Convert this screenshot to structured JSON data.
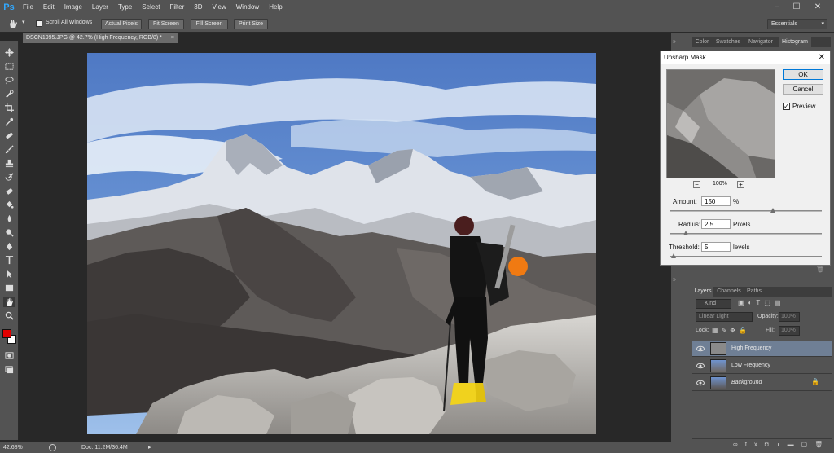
{
  "app": {
    "logo": "Ps"
  },
  "menu": [
    "File",
    "Edit",
    "Image",
    "Layer",
    "Type",
    "Select",
    "Filter",
    "3D",
    "View",
    "Window",
    "Help"
  ],
  "window_controls": {
    "minimize": "–",
    "maximize": "☐",
    "close": "✕"
  },
  "options_bar": {
    "scroll_all_windows": "Scroll All Windows",
    "buttons": [
      "Actual Pixels",
      "Fit Screen",
      "Fill Screen",
      "Print Size"
    ],
    "workspace": "Essentials"
  },
  "document": {
    "tab_title": "DSCN1995.JPG @ 42.7% (High Frequency, RGB/8) *",
    "close": "×"
  },
  "status": {
    "zoom": "42.68%",
    "doc": "Doc: 11.2M/36.4M"
  },
  "panel_tabs": [
    "Color",
    "Swatches",
    "Navigator",
    "Histogram"
  ],
  "dialog": {
    "title": "Unsharp Mask",
    "ok": "OK",
    "cancel": "Cancel",
    "preview_label": "Preview",
    "preview_checked": true,
    "zoom": "100%",
    "zoom_out": "−",
    "zoom_in": "+",
    "amount": {
      "label": "Amount:",
      "value": "150",
      "unit": "%",
      "fraction": 0.68
    },
    "radius": {
      "label": "Radius:",
      "value": "2.5",
      "unit": "Pixels",
      "fraction": 0.1
    },
    "threshold": {
      "label": "Threshold:",
      "value": "5",
      "unit": "levels",
      "fraction": 0.02
    }
  },
  "layers": {
    "tabs": [
      "Layers",
      "Channels",
      "Paths"
    ],
    "filter_kind": "Kind",
    "blend_mode": "Linear Light",
    "opacity_label": "Opacity:",
    "opacity_value": "100%",
    "lock_label": "Lock:",
    "fill_label": "Fill:",
    "fill_value": "100%",
    "items": [
      {
        "name": "High Frequency",
        "selected": true
      },
      {
        "name": "Low Frequency",
        "selected": false
      },
      {
        "name": "Background",
        "selected": false,
        "locked": true
      }
    ]
  },
  "colors": {
    "foreground": "#e10000",
    "background": "#ffffff",
    "selection": "#6f7f95"
  }
}
